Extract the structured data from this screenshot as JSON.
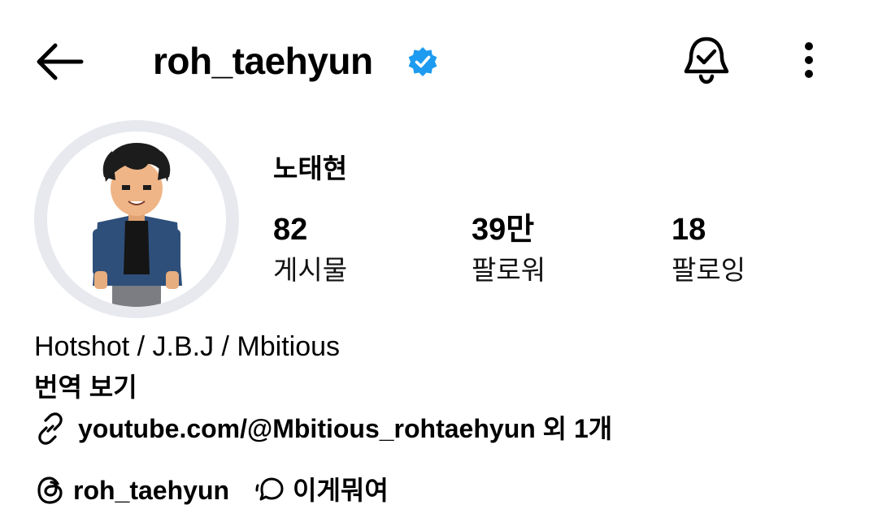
{
  "header": {
    "username": "roh_taehyun",
    "verified_color": "#1d9bf0"
  },
  "profile": {
    "display_name": "노태현",
    "avatar": "avatar-illustration"
  },
  "stats": {
    "posts": {
      "value": "82",
      "label": "게시물"
    },
    "followers": {
      "value": "39만",
      "label": "팔로워"
    },
    "following": {
      "value": "18",
      "label": "팔로잉"
    }
  },
  "bio": {
    "text": "Hotshot / J.B.J / Mbitious",
    "translate_label": "번역 보기",
    "link": "youtube.com/@Mbitious_rohtaehyun 외 1개"
  },
  "badges": {
    "threads_handle": "roh_taehyun",
    "note_text": "이게뭐여"
  },
  "icons": {
    "back": "back-arrow-icon",
    "verified": "verified-badge-icon",
    "bell": "notification-bell-icon",
    "more": "more-options-icon",
    "link": "link-icon",
    "threads": "threads-icon",
    "note": "chat-bubble-icon"
  }
}
